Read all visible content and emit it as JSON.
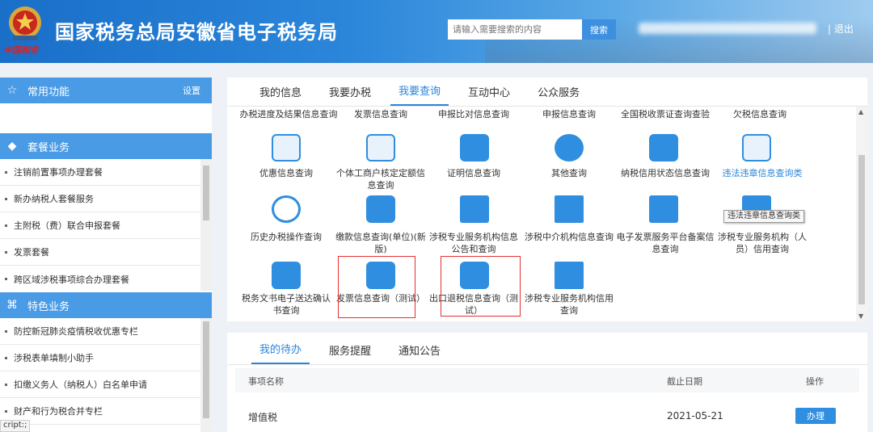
{
  "header": {
    "title": "国家税务总局安徽省电子税务局",
    "slogan": "中国税务",
    "search_placeholder": "请输入需要搜索的内容",
    "search_label": "搜索",
    "logout_label": "|  退出"
  },
  "sidebar": {
    "common": {
      "label": "常用功能",
      "settings": "设置"
    },
    "package": {
      "label": "套餐业务",
      "items": [
        "注销前置事项办理套餐",
        "新办纳税人套餐服务",
        "主附税（费）联合申报套餐",
        "发票套餐",
        "跨区域涉税事项综合办理套餐"
      ]
    },
    "featured": {
      "label": "特色业务",
      "items": [
        "防控新冠肺炎疫情税收优惠专栏",
        "涉税表单填制小助手",
        "扣缴义务人（纳税人）白名单申请",
        "财产和行为税合并专栏"
      ]
    }
  },
  "status_bar": "cript:;",
  "main": {
    "tabs": [
      "我的信息",
      "我要办税",
      "我要查询",
      "互动中心",
      "公众服务"
    ],
    "active_tab": 2,
    "top_row": [
      "办税进度及结果信息查询",
      "发票信息查询",
      "申报比对信息查询",
      "申报信息查询",
      "全国税收票证查询查验",
      "欠税信息查询"
    ],
    "row1": [
      "优惠信息查询",
      "个体工商户核定定额信息查询",
      "证明信息查询",
      "其他查询",
      "纳税信用状态信息查询",
      "违法违章信息查询类"
    ],
    "row2": [
      "历史办税操作查询",
      "缴款信息查询(单位)(新版)",
      "涉税专业服务机构信息公告和查询",
      "涉税中介机构信息查询",
      "电子发票服务平台备案信息查询",
      "涉税专业服务机构（人员）信用查询"
    ],
    "row3": [
      "税务文书电子送达确认书查询",
      "发票信息查询（测试）",
      "出口退税信息查询（测试）",
      "涉税专业服务机构信用查询"
    ],
    "tooltip": "违法违章信息查询类"
  },
  "todo": {
    "tabs": [
      "我的待办",
      "服务提醒",
      "通知公告"
    ],
    "columns": [
      "事项名称",
      "截止日期",
      "操作"
    ],
    "rows": [
      {
        "name": "增值税",
        "deadline": "2021-05-21",
        "action": "办理"
      }
    ]
  },
  "colors": {
    "accent": "#2b86da",
    "sidebar_head": "#4a9be6",
    "highlight_box": "#e53030"
  }
}
